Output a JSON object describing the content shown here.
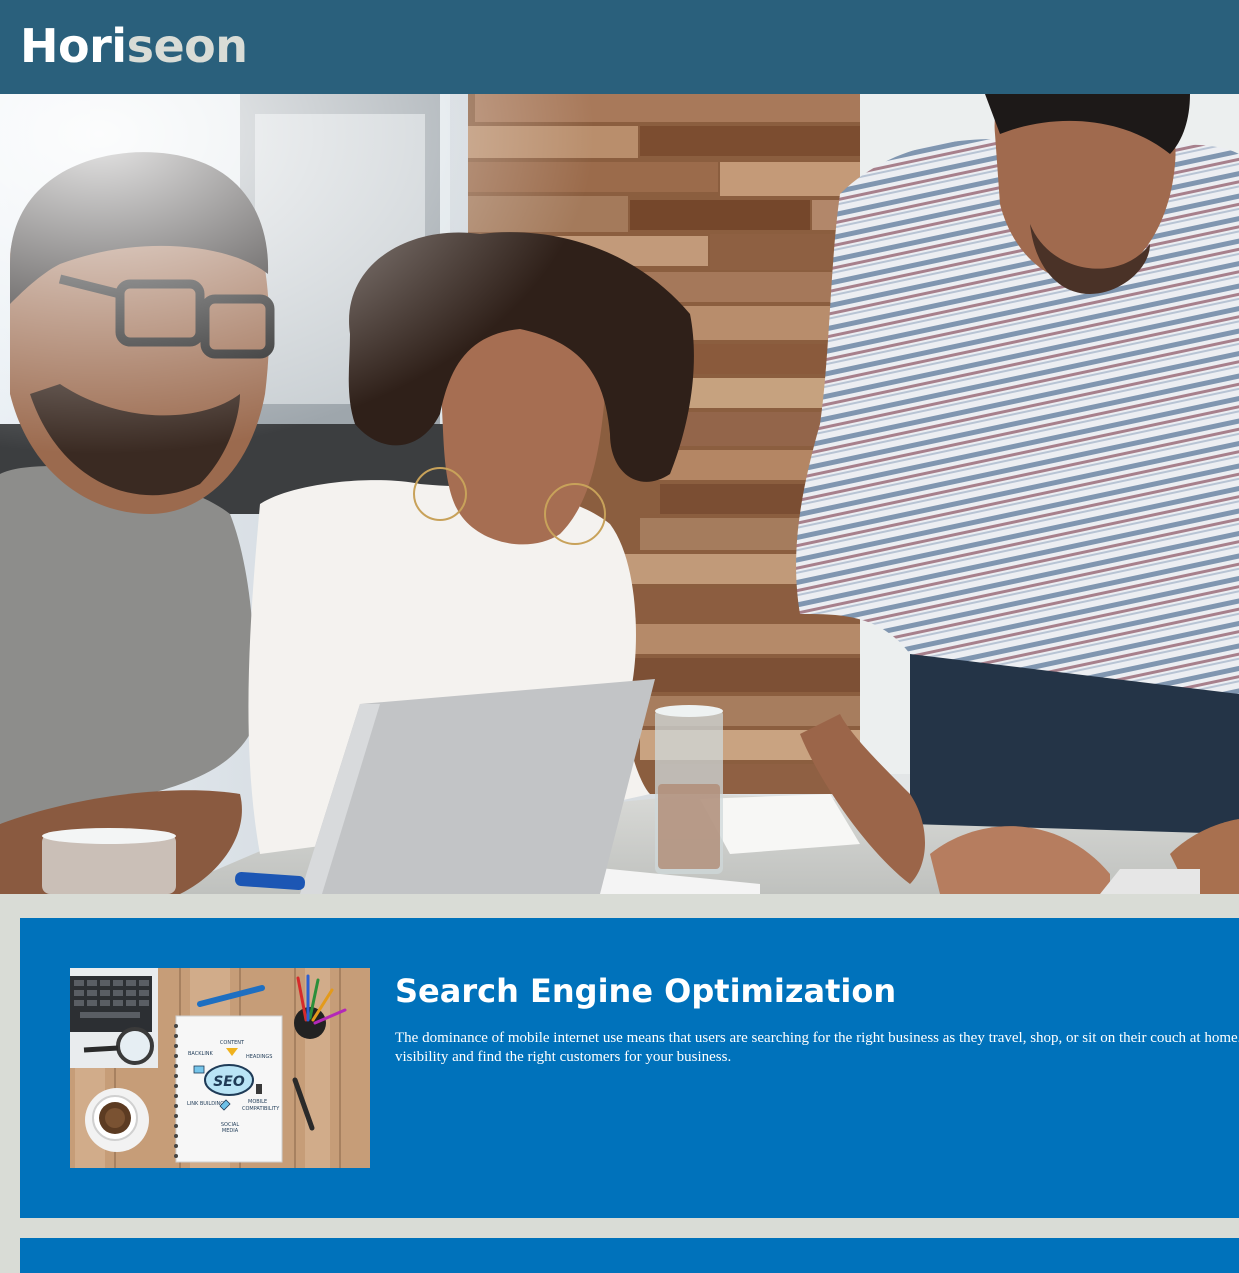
{
  "header": {
    "logo_part1": "Hori",
    "logo_part2": "seon"
  },
  "hero": {
    "image_description_icon": "office-team-photo"
  },
  "search_engine_optimization": {
    "title": "Search Engine Optimization",
    "text": "The dominance of mobile internet use means that users are searching for the right business as they travel, shop, or sit on their couch at home. Search Engine Optimization (SEO) allows you to increase your visibility and find the right customers for your business.",
    "image_labels": {
      "center": "SEO",
      "content": "CONTENT",
      "backlink": "BACKLINK",
      "headings": "HEADINGS",
      "link_building": "LINK BUILDING",
      "mobile": "MOBILE",
      "compatibility": "COMPATIBILITY",
      "social": "SOCIAL",
      "media": "MEDIA"
    }
  },
  "colors": {
    "header_bg": "#2a607c",
    "card_bg": "#0072bb",
    "page_bg": "#d9dcd6",
    "logo_accent": "#d9dcd6"
  }
}
